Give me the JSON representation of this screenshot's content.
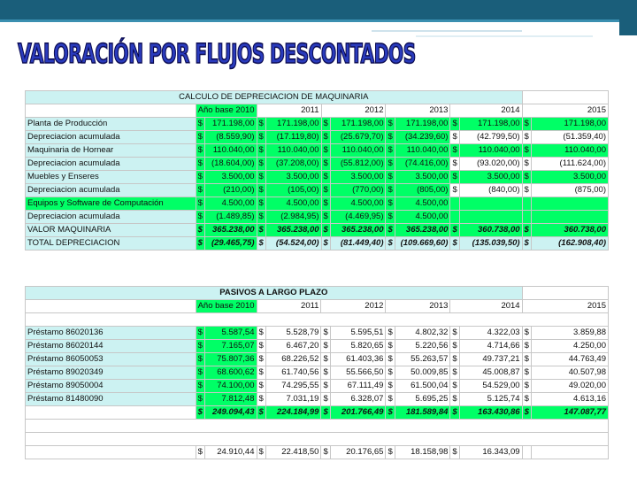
{
  "slide": {
    "title": "VALORACIÓN POR FLUJOS DESCONTADOS"
  },
  "depreciation": {
    "section_title": "CALCULO DE DEPRECIACION DE MAQUINARIA",
    "year_headers": [
      "Año base 2010",
      "2011",
      "2012",
      "2013",
      "2014",
      "2015"
    ],
    "rows": [
      {
        "label": "Planta de Producción",
        "values": [
          "171.198,00",
          "171.198,00",
          "171.198,00",
          "171.198,00",
          "171.198,00",
          "171.198,00"
        ]
      },
      {
        "label": "Depreciacion acumulada",
        "values": [
          "(8.559,90)",
          "(17.119,80)",
          "(25.679,70)",
          "(34.239,60)",
          "(42.799,50)",
          "(51.359,40)"
        ]
      },
      {
        "label": "Maquinaria de Hornear",
        "values": [
          "110.040,00",
          "110.040,00",
          "110.040,00",
          "110.040,00",
          "110.040,00",
          "110.040,00"
        ]
      },
      {
        "label": "Depreciacion acumulada",
        "values": [
          "(18.604,00)",
          "(37.208,00)",
          "(55.812,00)",
          "(74.416,00)",
          "(93.020,00)",
          "(111.624,00)"
        ]
      },
      {
        "label": "Muebles y Enseres",
        "values": [
          "3.500,00",
          "3.500,00",
          "3.500,00",
          "3.500,00",
          "3.500,00",
          "3.500,00"
        ]
      },
      {
        "label": "Depreciacion acumulada",
        "values": [
          "(210,00)",
          "(105,00)",
          "(770,00)",
          "(805,00)",
          "(840,00)",
          "(875,00)"
        ]
      },
      {
        "label": "Equipos y Software de Computación",
        "values": [
          "4.500,00",
          "4.500,00",
          "4.500,00",
          "4.500,00",
          "",
          ""
        ]
      },
      {
        "label": "Depreciacion acumulada",
        "values": [
          "(1.489,85)",
          "(2.984,95)",
          "(4.469,95)",
          "4.500,00",
          "",
          ""
        ]
      },
      {
        "label": "VALOR MAQUINARIA",
        "values": [
          "365.238,00",
          "365.238,00",
          "365.238,00",
          "365.238,00",
          "360.738,00",
          "360.738,00"
        ]
      },
      {
        "label": "TOTAL DEPRECIACION",
        "values": [
          "(29.465,75)",
          "(54.524,00)",
          "(81.449,40)",
          "(109.669,60)",
          "(135.039,50)",
          "(162.908,40)"
        ]
      }
    ]
  },
  "liabilities": {
    "section_title": "PASIVOS A LARGO PLAZO",
    "year_headers": [
      "Año base 2010",
      "2011",
      "2012",
      "2013",
      "2014",
      "2015"
    ],
    "rows": [
      {
        "label": "Préstamo 86020136",
        "values": [
          "5.587,54",
          "5.528,79",
          "5.595,51",
          "4.802,32",
          "4.322,03",
          "3.859,88"
        ]
      },
      {
        "label": "Préstamo 86020144",
        "values": [
          "7.165,07",
          "6.467,20",
          "5.820,65",
          "5.220,56",
          "4.714,66",
          "4.250,00"
        ]
      },
      {
        "label": "Préstamo 86050053",
        "values": [
          "75.807,36",
          "68.226,52",
          "61.403,36",
          "55.263,57",
          "49.737,21",
          "44.763,49"
        ]
      },
      {
        "label": "Préstamo 89020349",
        "values": [
          "68.600,62",
          "61.740,56",
          "55.566,50",
          "50.009,85",
          "45.008,87",
          "40.507,98"
        ]
      },
      {
        "label": "Préstamo 89050004",
        "values": [
          "74.100,00",
          "74.295,55",
          "67.111,49",
          "61.500,04",
          "54.529,00",
          "49.020,00"
        ]
      },
      {
        "label": "Préstamo 81480090",
        "values": [
          "7.812,48",
          "7.031,19",
          "6.328,07",
          "5.695,25",
          "5.125,74",
          "4.613,16"
        ]
      }
    ],
    "total": [
      "249.094,43",
      "224.184,99",
      "201.766,49",
      "181.589,84",
      "163.430,86",
      "147.087,77"
    ],
    "footer": [
      "24.910,44",
      "22.418,50",
      "20.176,65",
      "18.158,98",
      "16.343,09",
      ""
    ]
  },
  "colors": {
    "green": "#00ff66",
    "cyan": "#ccf2f2",
    "title": "#2a3bbd"
  }
}
